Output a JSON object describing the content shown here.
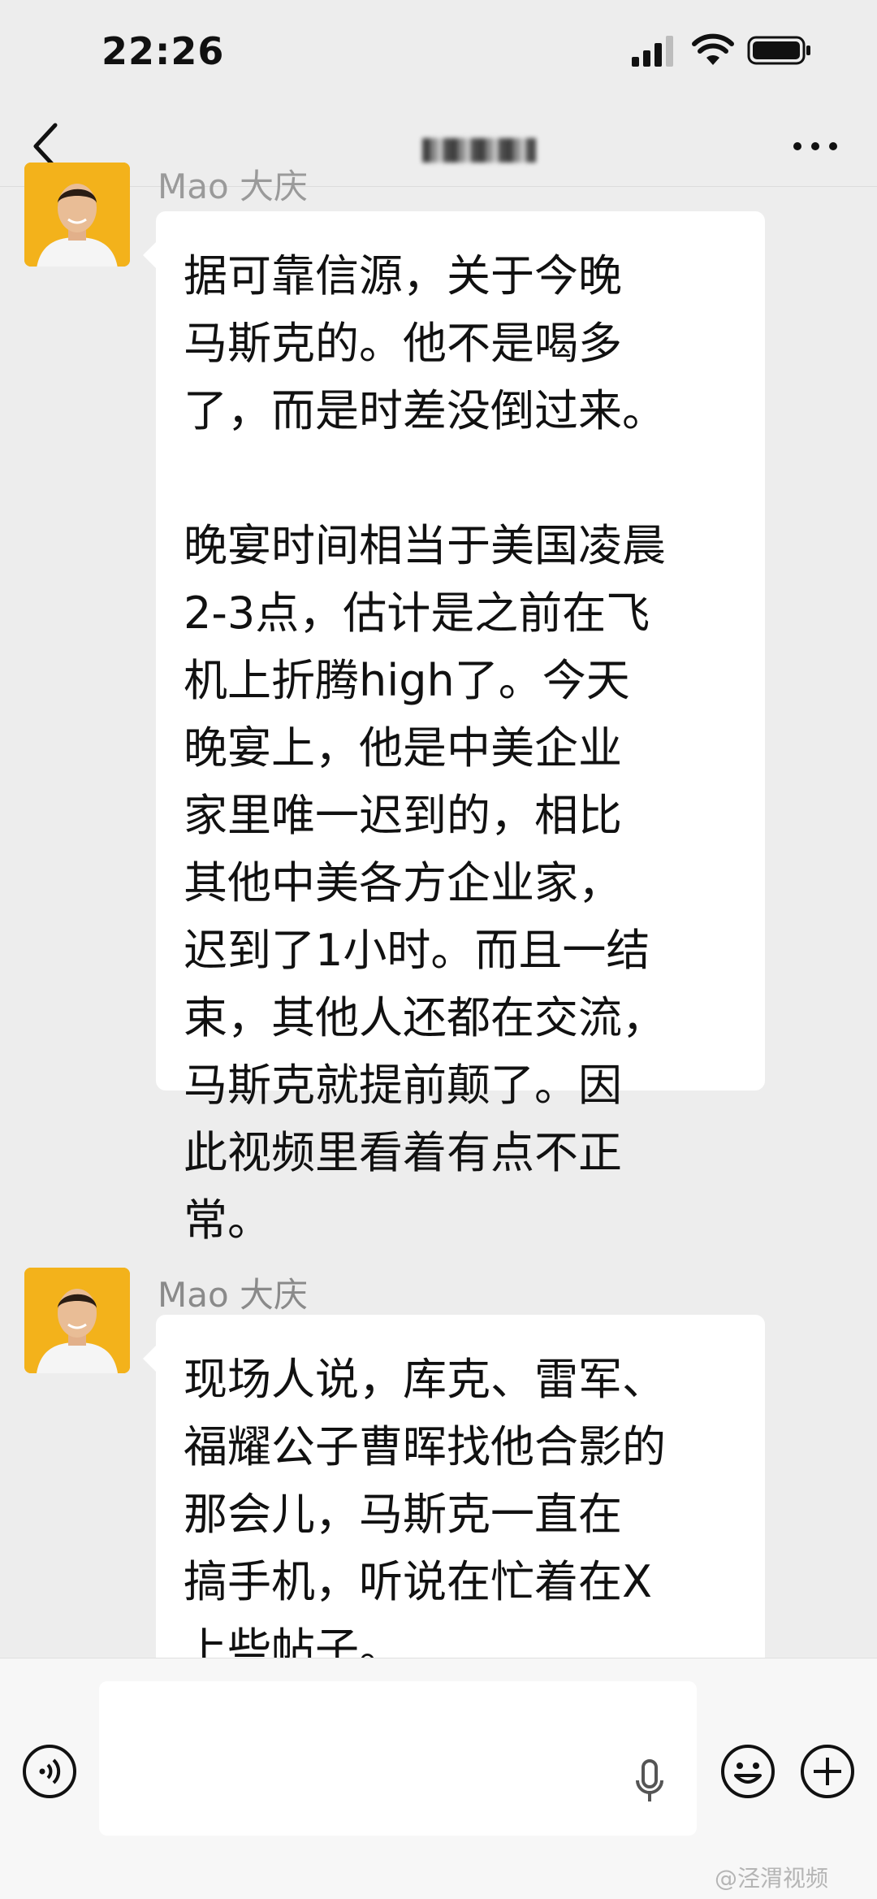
{
  "status_bar": {
    "time": "22:26"
  },
  "nav": {
    "title": ""
  },
  "messages": [
    {
      "sender": "Mao 大庆",
      "text": "据可靠信源，关于今晚\n马斯克的。他不是喝多\n了，而是时差没倒过来。\n\n晚宴时间相当于美国凌晨\n2-3点，估计是之前在飞\n机上折腾high了。今天\n晚宴上，他是中美企业\n家里唯一迟到的，相比\n其他中美各方企业家，\n迟到了1小时。而且一结\n束，其他人还都在交流，\n马斯克就提前颠了。因\n此视频里看着有点不正\n常。"
    },
    {
      "sender": "Mao 大庆",
      "text": "现场人说，库克、雷军、\n福耀公子曹晖找他合影的\n那会儿，马斯克一直在\n搞手机，听说在忙着在X\n上些帖子。"
    }
  ],
  "input": {
    "placeholder": ""
  },
  "watermark": "@泾渭视频",
  "colors": {
    "background": "#ededed",
    "bubble": "#ffffff",
    "name_gray": "#8a8a8a",
    "avatar_bg": "#f3b21b"
  }
}
